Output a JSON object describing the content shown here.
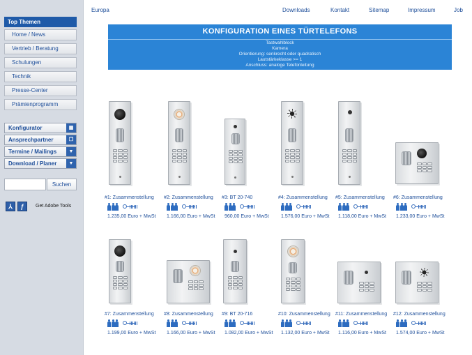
{
  "sidebar": {
    "header": "Top Themen",
    "nav": [
      "Home / News",
      "Vertrieb / Beratung",
      "Schulungen",
      "Technik",
      "Presse-Center",
      "Prämienprogramm"
    ],
    "tools": [
      "Konfigurator",
      "Ansprechpartner",
      "Termine / Mailings",
      "Download / Planer"
    ],
    "search": {
      "value": "",
      "button": "Suchen"
    },
    "adobe": "Get Adobe Tools"
  },
  "toplinks": [
    "Europa",
    "Downloads",
    "Kontakt",
    "Sitemap",
    "Impressum",
    "Job"
  ],
  "banner": {
    "title": "KONFIGURATION EINES TÜRTELEFONS",
    "lines": [
      "Tastwahlblock",
      "Kamera",
      "Orientierung: senkrecht oder quadratisch",
      "Lautstärkeklasse >= 1",
      "Anschluss: analoge Telefonleitung"
    ]
  },
  "products": [
    {
      "label": "#1: Zusammenstellung",
      "price": "1.235,00 Euro + MwSt"
    },
    {
      "label": "#2: Zusammenstellung",
      "price": "1.166,00 Euro + MwSt"
    },
    {
      "label": "#3: BT 20-740",
      "price": "960,00 Euro + MwSt"
    },
    {
      "label": "#4: Zusammenstellung",
      "price": "1.576,00 Euro + MwSt"
    },
    {
      "label": "#5: Zusammenstellung",
      "price": "1.118,00 Euro + MwSt"
    },
    {
      "label": "#6: Zusammenstellung",
      "price": "1.233,00 Euro + MwSt"
    },
    {
      "label": "#7: Zusammenstellung",
      "price": "1.199,00 Euro + MwSt"
    },
    {
      "label": "#8: Zusammenstellung",
      "price": "1.166,00 Euro + MwSt"
    },
    {
      "label": "#9: BT 20-716",
      "price": "1.082,00 Euro + MwSt"
    },
    {
      "label": "#10: Zusammenstellung",
      "price": "1.132,00 Euro + MwSt"
    },
    {
      "label": "#11: Zusammenstellung",
      "price": "1.116,00 Euro + MwSt"
    },
    {
      "label": "#12: Zusammenstellung",
      "price": "1.574,00 Euro + MwSt"
    }
  ],
  "colors": {
    "sidebar_bg": "#d6dbe3",
    "header_bg": "#1f5aa8",
    "banner_bg": "#2b84d6",
    "link": "#1f4f9a"
  }
}
